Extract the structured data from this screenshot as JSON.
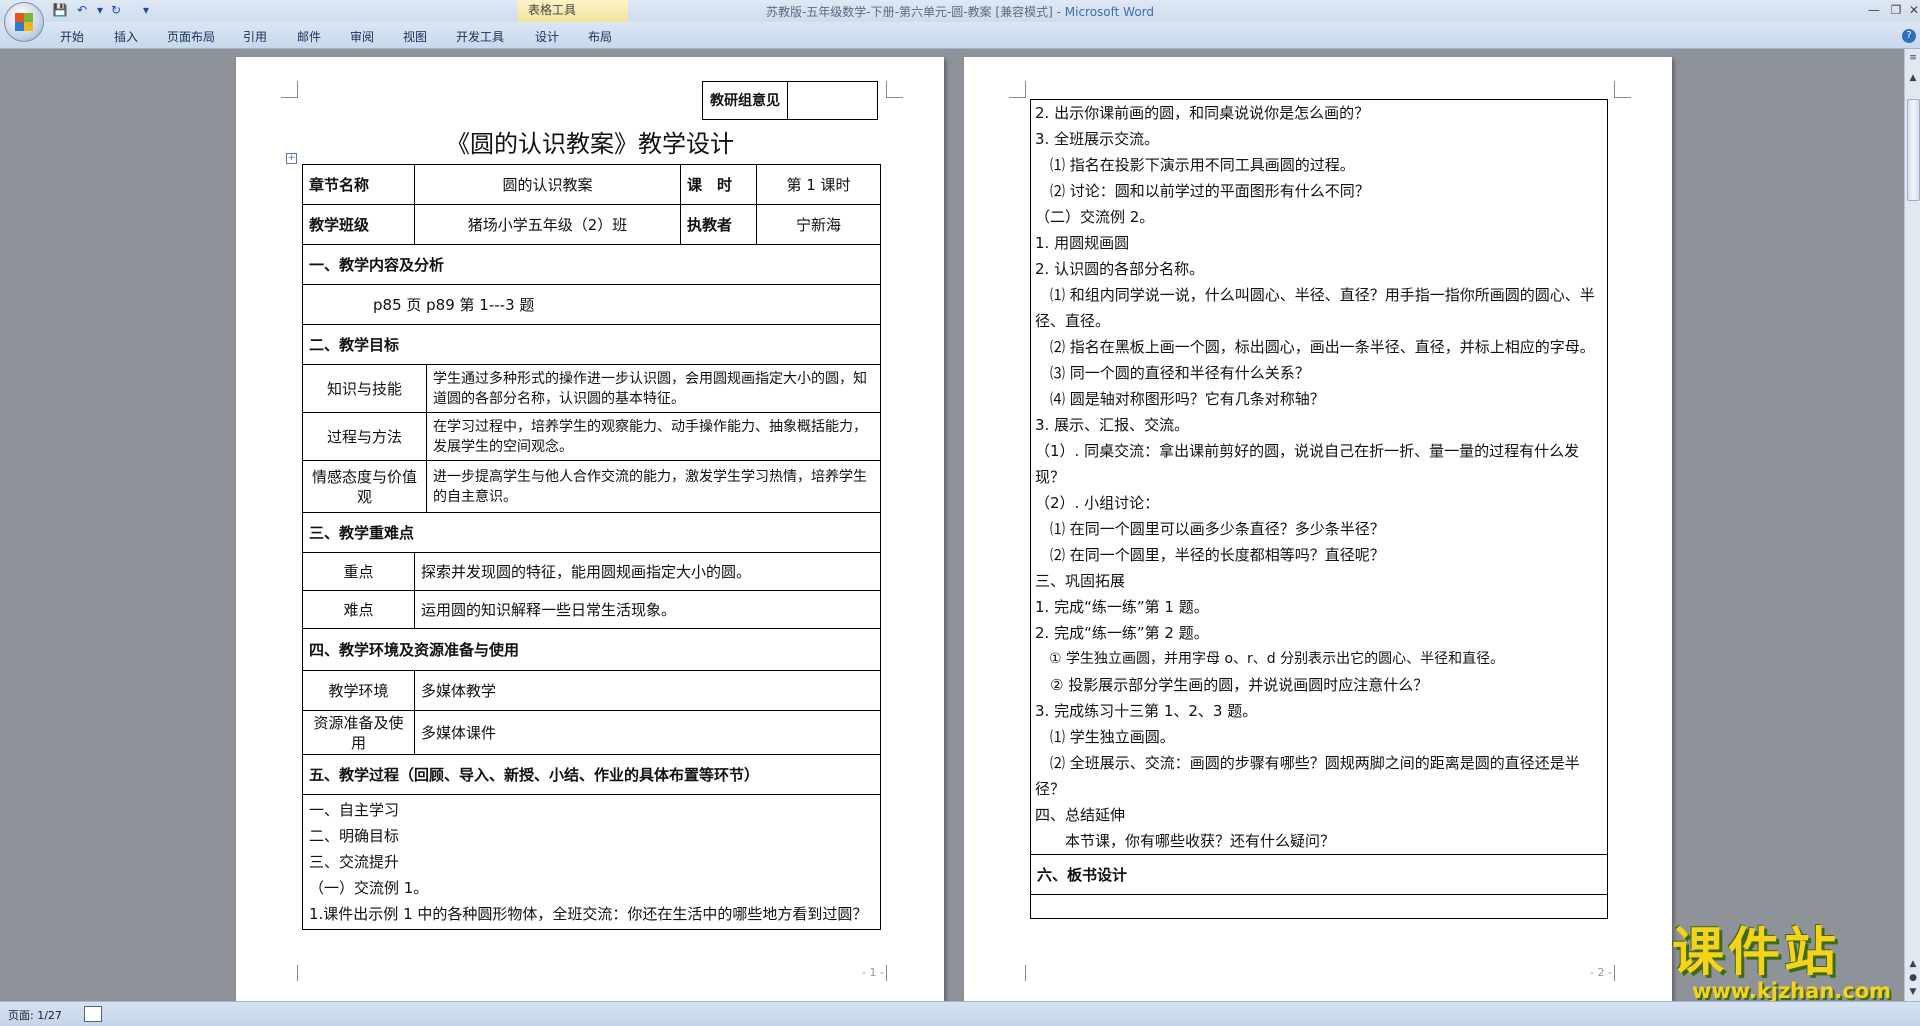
{
  "window": {
    "title_doc": "苏教版-五年级数学-下册-第六单元-圆-教案 [兼容模式] - ",
    "title_app": "Microsoft Word",
    "context_group": "表格工具"
  },
  "ribbon": {
    "tabs": [
      "开始",
      "插入",
      "页面布局",
      "引用",
      "邮件",
      "审阅",
      "视图",
      "开发工具",
      "设计",
      "布局"
    ]
  },
  "page1": {
    "review_label": "教研组意见",
    "title": "《圆的认识教案》教学设计",
    "info": {
      "chapter_label": "章节名称",
      "chapter_value": "圆的认识教案",
      "period_label": "课　时",
      "period_value": "第 1 课时",
      "class_label": "教学班级",
      "class_value": "猪场小学五年级（2）班",
      "teacher_label": "执教者",
      "teacher_value": "宁新海"
    },
    "section1": "一、教学内容及分析",
    "content": "p85 页 p89 第 1---3 题",
    "section2": "二、教学目标",
    "goals": [
      {
        "label": "知识与技能",
        "text": "学生通过多种形式的操作进一步认识圆，会用圆规画指定大小的圆，知道圆的各部分名称，认识圆的基本特征。"
      },
      {
        "label": "过程与方法",
        "text": "在学习过程中，培养学生的观察能力、动手操作能力、抽象概括能力，发展学生的空间观念。"
      },
      {
        "label": "情感态度与价值观",
        "text": "进一步提高学生与他人合作交流的能力，激发学生学习热情，培养学生的自主意识。"
      }
    ],
    "section3": "三、教学重难点",
    "key_points": [
      {
        "label": "重点",
        "text": "探索并发现圆的特征，能用圆规画指定大小的圆。"
      },
      {
        "label": "难点",
        "text": "运用圆的知识解释一些日常生活现象。"
      }
    ],
    "section4": "四、教学环境及资源准备与使用",
    "environment": [
      {
        "label": "教学环境",
        "text": "多媒体教学"
      },
      {
        "label": "资源准备及使用",
        "text": "多媒体课件"
      }
    ],
    "section5": "五、教学过程（回顾、导入、新授、小结、作业的具体布置等环节）",
    "process": [
      "一、自主学习",
      "二、明确目标",
      "三、交流提升",
      "（一）交流例 1。",
      "1.课件出示例 1 中的各种圆形物体，全班交流：你还在生活中的哪些地方看到过圆？"
    ],
    "page_number": "- 1 -"
  },
  "page2": {
    "lines": [
      "2. 出示你课前画的圆，和同桌说说你是怎么画的？",
      "3. 全班展示交流。",
      "　⑴ 指名在投影下演示用不同工具画圆的过程。",
      "　⑵ 讨论：圆和以前学过的平面图形有什么不同？",
      "（二）交流例 2。",
      "1. 用圆规画圆",
      "2. 认识圆的各部分名称。",
      "　⑴ 和组内同学说一说，什么叫圆心、半径、直径？用手指一指你所画圆的圆心、半径、直径。",
      "　⑵ 指名在黑板上画一个圆，标出圆心，画出一条半径、直径，并标上相应的字母。",
      "　⑶ 同一个圆的直径和半径有什么关系？",
      "　⑷ 圆是轴对称图形吗？它有几条对称轴？",
      "3. 展示、汇报、交流。",
      "（1）. 同桌交流：拿出课前剪好的圆，说说自己在折一折、量一量的过程有什么发现？",
      "（2）. 小组讨论：",
      "　⑴ 在同一个圆里可以画多少条直径？多少条半径？",
      "　⑵ 在同一个圆里，半径的长度都相等吗？直径呢？",
      "三、巩固拓展",
      "1. 完成“练一练”第 1 题。",
      "2. 完成“练一练”第 2 题。",
      "　① 学生独立画圆，并用字母 o、r、d 分别表示出它的圆心、半径和直径。",
      "　② 投影展示部分学生画的圆，并说说画圆时应注意什么？",
      "3. 完成练习十三第 1、2、3 题。",
      "　⑴ 学生独立画圆。",
      "　⑵ 全班展示、交流：画圆的步骤有哪些？圆规两脚之间的距离是圆的直径还是半径？",
      "四、总结延伸",
      "　　本节课，你有哪些收获？还有什么疑问？"
    ],
    "section6": "六、板书设计",
    "page_number": "- 2 -"
  },
  "status": {
    "page": "页面: 1/27"
  },
  "watermark": {
    "main": "课件站",
    "url": "www.kjzhan.com"
  }
}
